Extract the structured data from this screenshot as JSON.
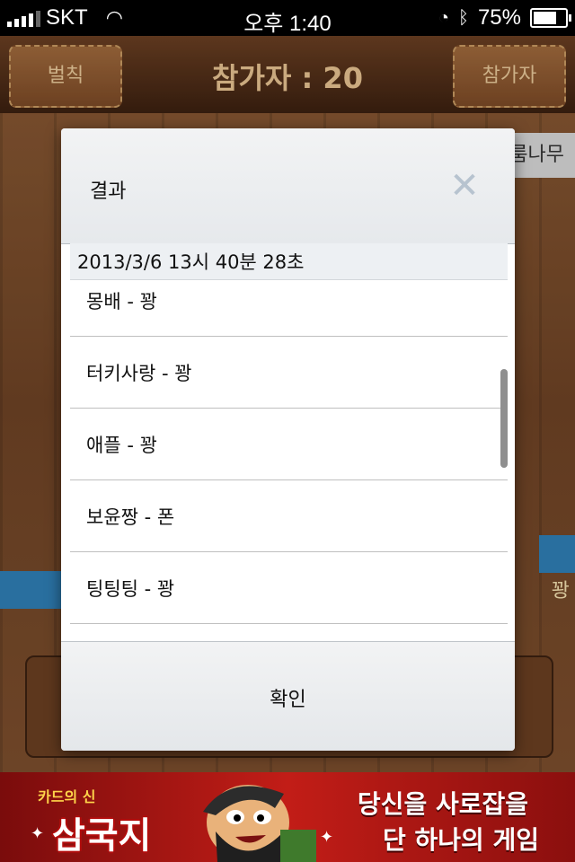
{
  "status_bar": {
    "carrier": "SKT",
    "time": "오후 1:40",
    "battery": "75%",
    "battery_level": 0.75
  },
  "game": {
    "left_button": "벌칙",
    "title": "참가자 : 20",
    "right_button": "참가자",
    "side_label_top": "룸나무",
    "side_label_right": "꽝"
  },
  "dialog": {
    "title": "결과",
    "list_header": "2013/3/6  13시 40분 28초",
    "rows": [
      "몽배 - 꽝",
      "터키사랑 - 꽝",
      "애플 - 꽝",
      "보윤짱 - 폰",
      "팅팅팅 - 꽝"
    ],
    "ok_label": "확인"
  },
  "ad": {
    "brand_small": "카드의 신",
    "brand_big": "삼국지",
    "tagline_1": "당신을 사로잡을",
    "tagline_2": "단 하나의 게임"
  }
}
